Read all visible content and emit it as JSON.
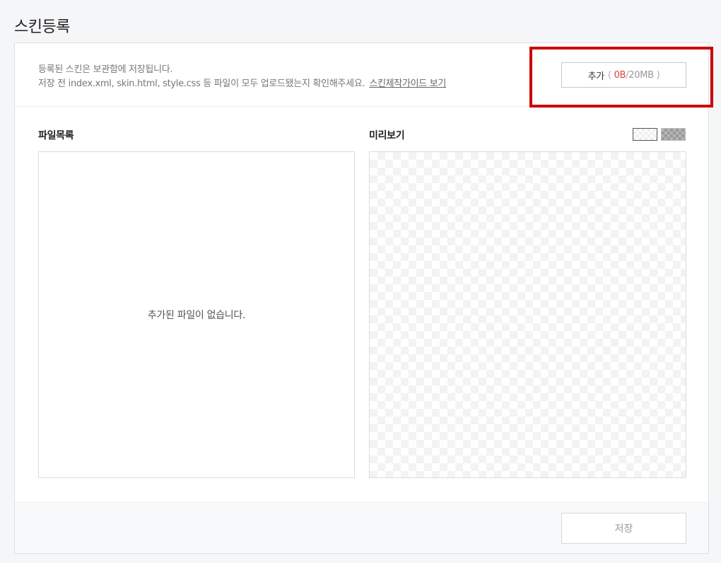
{
  "page": {
    "title": "스킨등록"
  },
  "info": {
    "line1": "등록된 스킨은 보관함에 저장됩니다.",
    "line2": "저장 전 index.xml, skin.html, style.css 등 파일이 모두 업로드됐는지 확인해주세요.",
    "guide_link": "스킨제작가이드 보기"
  },
  "add_button": {
    "label": "추가",
    "paren_open": "(",
    "used": "0B",
    "separator": "/",
    "total": "20MB",
    "paren_close": ")"
  },
  "files": {
    "label": "파일목록",
    "empty_message": "추가된 파일이 없습니다."
  },
  "preview": {
    "label": "미리보기"
  },
  "footer": {
    "save_label": "저장"
  },
  "colors": {
    "highlight": "#cc0000",
    "used_size": "#e0413a"
  }
}
